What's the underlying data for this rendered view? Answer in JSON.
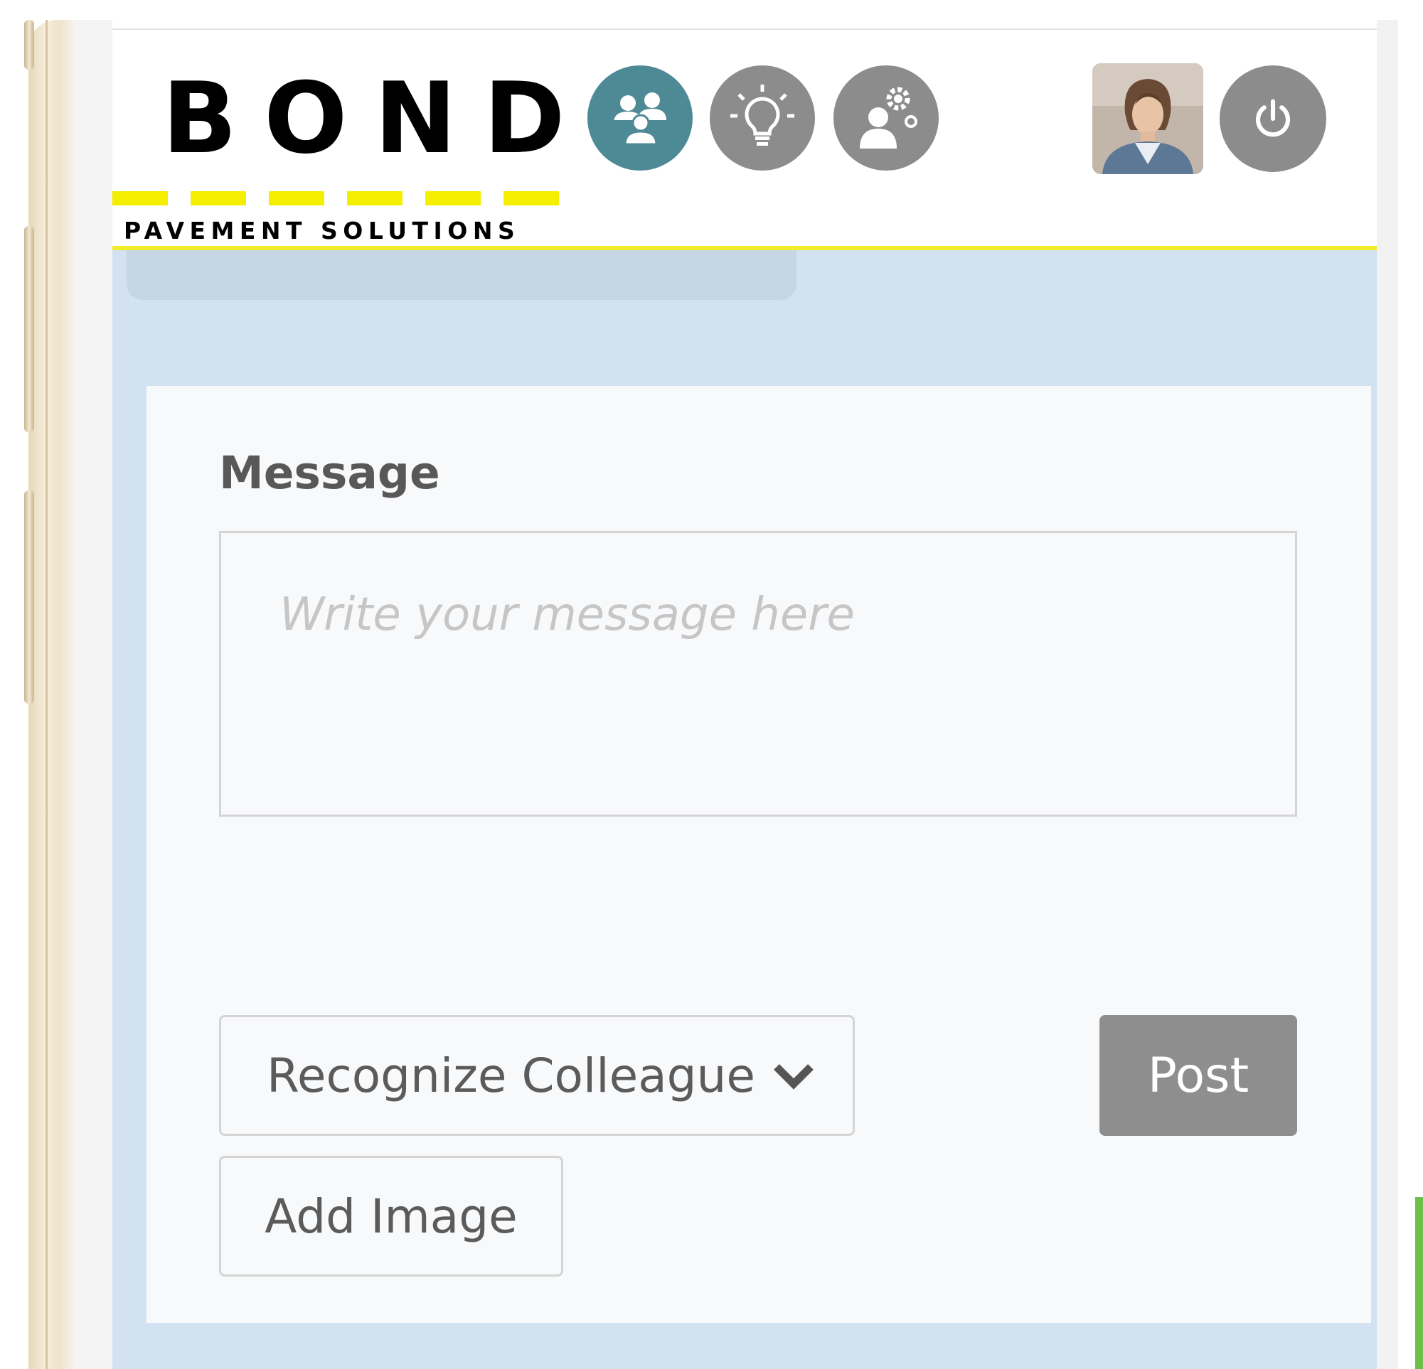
{
  "header": {
    "logo": {
      "name": "BOND",
      "tagline": "PAVEMENT SOLUTIONS",
      "accent_color": "#f4ef00"
    },
    "nav": [
      {
        "icon": "colleagues-icon",
        "active": true,
        "color": "#4e8a96"
      },
      {
        "icon": "lightbulb-icon",
        "active": false,
        "color": "#8c8c8c"
      },
      {
        "icon": "person-gear-icon",
        "active": false,
        "color": "#8c8c8c"
      }
    ],
    "user_avatar": "user-avatar-photo",
    "power_icon": "power-icon"
  },
  "composer": {
    "message_label": "Message",
    "message_placeholder": "Write your message here",
    "message_value": "",
    "post_type_select": {
      "selected": "Recognize Colleague",
      "icon": "chevron-down-icon"
    },
    "post_button_label": "Post",
    "add_image_label": "Add Image"
  },
  "colors": {
    "page_background": "#d3e2f0",
    "card_background": "#f8f9fb",
    "header_border": "#f1ec2a",
    "button_gray": "#8e8e8e",
    "accent_teal": "#4e8a96"
  }
}
